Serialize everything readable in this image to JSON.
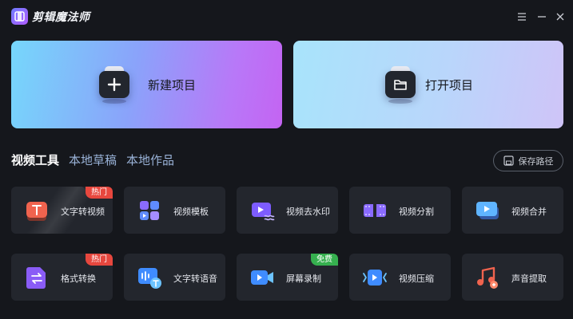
{
  "app": {
    "title": "剪辑魔法师"
  },
  "cards": {
    "new_project": "新建项目",
    "open_project": "打开项目"
  },
  "tabs": [
    {
      "label": "视频工具",
      "active": true
    },
    {
      "label": "本地草稿",
      "active": false
    },
    {
      "label": "本地作品",
      "active": false
    }
  ],
  "save_path": {
    "label": "保存路径"
  },
  "tools": [
    {
      "label": "文字转视频",
      "tag": "热门",
      "icon": "text-t-icon"
    },
    {
      "label": "视频模板",
      "tag": "",
      "icon": "template-grid-icon"
    },
    {
      "label": "视频去水印",
      "tag": "",
      "icon": "watermark-remove-icon"
    },
    {
      "label": "视频分割",
      "tag": "",
      "icon": "film-split-icon"
    },
    {
      "label": "视频合并",
      "tag": "",
      "icon": "video-merge-icon"
    },
    {
      "label": "格式转换",
      "tag": "热门",
      "icon": "format-convert-icon"
    },
    {
      "label": "文字转语音",
      "tag": "",
      "icon": "text-to-speech-icon"
    },
    {
      "label": "屏幕录制",
      "tag": "免费",
      "icon": "screen-record-icon"
    },
    {
      "label": "视频压缩",
      "tag": "",
      "icon": "video-compress-icon"
    },
    {
      "label": "声音提取",
      "tag": "",
      "icon": "audio-extract-icon"
    }
  ],
  "colors": {
    "background": "#15171c",
    "card": "#23262d",
    "hot_tag": "#e7473e",
    "free_tag": "#36b04f"
  }
}
